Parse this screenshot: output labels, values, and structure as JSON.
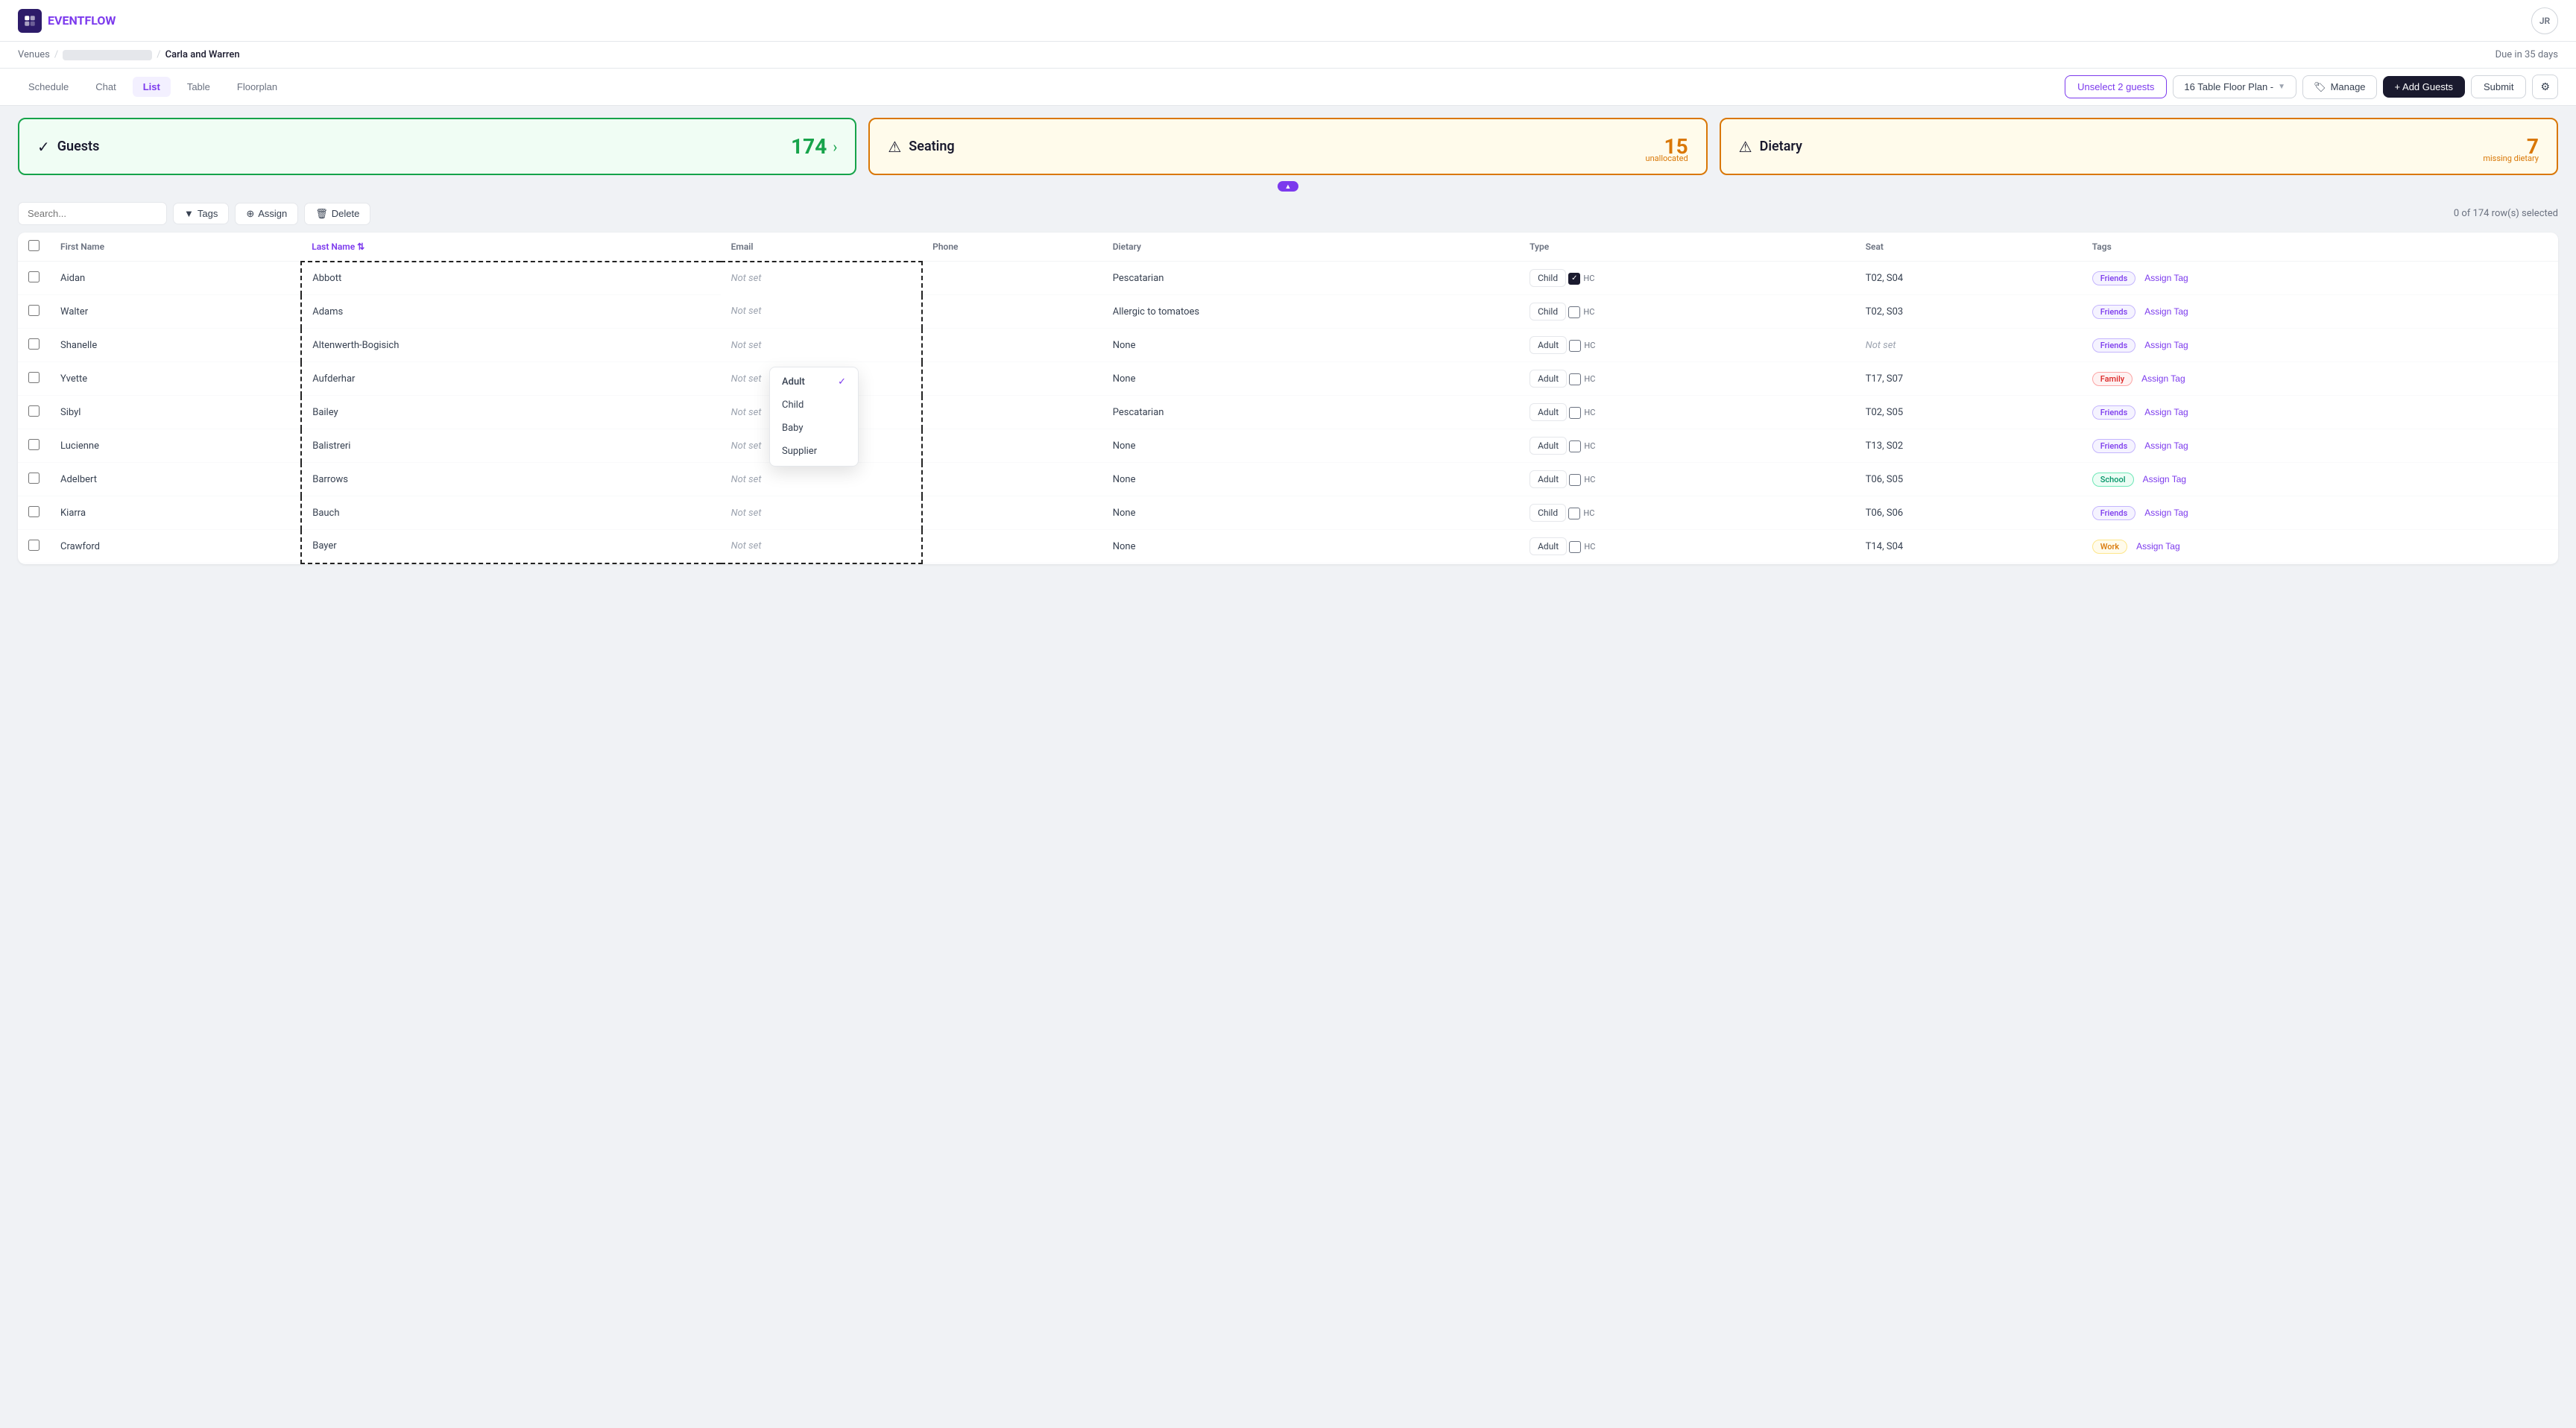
{
  "app": {
    "name_part1": "EVENT",
    "name_part2": "FLOW",
    "avatar": "JR"
  },
  "breadcrumb": {
    "venues": "Venues",
    "event": "Carla and Warren",
    "separator": "/"
  },
  "due": "Due in 35 days",
  "tabs": [
    {
      "id": "schedule",
      "label": "Schedule"
    },
    {
      "id": "chat",
      "label": "Chat"
    },
    {
      "id": "list",
      "label": "List",
      "active": true
    },
    {
      "id": "table",
      "label": "Table"
    },
    {
      "id": "floorplan",
      "label": "Floorplan"
    }
  ],
  "toolbar": {
    "unselect_label": "Unselect 2 guests",
    "floor_plan_label": "16 Table Floor Plan -",
    "manage_label": "Manage",
    "add_label": "+ Add Guests",
    "submit_label": "Submit"
  },
  "stats": {
    "guests": {
      "label": "Guests",
      "count": "174"
    },
    "seating": {
      "label": "Seating",
      "count": "15",
      "sub": "unallocated"
    },
    "dietary": {
      "label": "Dietary",
      "count": "7",
      "sub": "missing dietary"
    }
  },
  "list_toolbar": {
    "search_placeholder": "Search...",
    "tags_label": "Tags",
    "assign_label": "Assign",
    "delete_label": "Delete",
    "row_count": "0 of 174 row(s) selected"
  },
  "columns": [
    "First Name",
    "Last Name",
    "Email",
    "Phone",
    "Dietary",
    "Type",
    "Seat",
    "Tags"
  ],
  "type_dropdown": {
    "options": [
      "Adult",
      "Child",
      "Baby",
      "Supplier"
    ],
    "selected": "Adult"
  },
  "guests": [
    {
      "first": "Aidan",
      "last": "Abbott",
      "email_set": false,
      "phone": "",
      "dietary": "Pescatarian",
      "type": "Child",
      "hc": true,
      "seat": "T02, S04",
      "tag": "Friends"
    },
    {
      "first": "Walter",
      "last": "Adams",
      "email_set": false,
      "phone": "",
      "dietary": "Allergic to tomatoes",
      "type": "Child",
      "hc": false,
      "seat": "T02, S03",
      "tag": "Friends"
    },
    {
      "first": "Shanelle",
      "last": "Altenwerth-Bogisich",
      "email_set": false,
      "phone": "",
      "dietary": "None",
      "type": "Adult",
      "hc": false,
      "seat_set": false,
      "tag": "Friends",
      "dropdown_open": true
    },
    {
      "first": "Yvette",
      "last": "Aufderhar",
      "email_set": false,
      "phone": "",
      "dietary": "None",
      "type": "Adult",
      "hc": false,
      "seat": "T17, S07",
      "tag": "Family"
    },
    {
      "first": "Sibyl",
      "last": "Bailey",
      "email_set": false,
      "phone": "",
      "dietary": "Pescatarian",
      "type": "Adult",
      "hc": false,
      "seat": "T02, S05",
      "tag": "Friends"
    },
    {
      "first": "Lucienne",
      "last": "Balistreri",
      "email_set": false,
      "phone": "",
      "dietary": "None",
      "type": "Adult",
      "hc": false,
      "seat": "T13, S02",
      "tag": "Friends"
    },
    {
      "first": "Adelbert",
      "last": "Barrows",
      "email_set": false,
      "phone": "",
      "dietary": "None",
      "type": "Adult",
      "hc": false,
      "seat": "T06, S05",
      "tag": "School"
    },
    {
      "first": "Kiarra",
      "last": "Bauch",
      "email_set": false,
      "phone": "",
      "dietary": "None",
      "type": "Child",
      "hc": false,
      "seat": "T06, S06",
      "tag": "Friends"
    },
    {
      "first": "Crawford",
      "last": "Bayer",
      "email_set": false,
      "phone": "",
      "dietary": "None",
      "type": "Adult",
      "hc": false,
      "seat": "T14, S04",
      "tag": "Work"
    }
  ]
}
